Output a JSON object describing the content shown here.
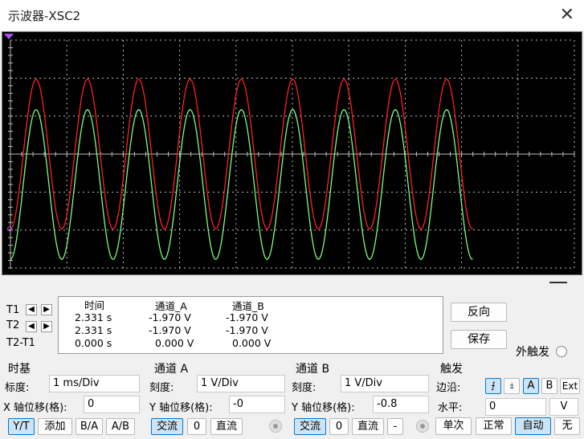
{
  "window": {
    "title": "示波器-XSC2",
    "close_glyph": "✕"
  },
  "screen": {
    "colors": {
      "background": "#000000",
      "grid": "#bdbdbd",
      "channel_a": "#ff2020",
      "channel_b": "#7dfc7d"
    }
  },
  "chart_data": {
    "type": "line",
    "x_unit": "div",
    "y_unit": "div",
    "xlim": [
      0,
      10
    ],
    "ylim": [
      -3,
      3
    ],
    "grid": true,
    "series": [
      {
        "name": "通道_A",
        "color": "#ff2020",
        "offset": 0,
        "amplitude": 1.97,
        "period_div": 0.91,
        "x_end": 8.2
      },
      {
        "name": "通道_B",
        "color": "#7dfc7d",
        "offset": -0.8,
        "amplitude": 1.97,
        "period_div": 0.91,
        "x_end": 8.2
      }
    ]
  },
  "readout": {
    "headers": [
      "时间",
      "通道_A",
      "通道_B"
    ],
    "rows": [
      {
        "label": "T1",
        "time": "2.331 s",
        "a": "-1.970 V",
        "b": "-1.970 V"
      },
      {
        "label": "T2",
        "time": "2.331 s",
        "a": "-1.970 V",
        "b": "-1.970 V"
      },
      {
        "label": "T2-T1",
        "time": "0.000 s",
        "a": "0.000 V",
        "b": "0.000 V"
      }
    ],
    "arrow_left": "◀",
    "arrow_right": "▶"
  },
  "buttons": {
    "reverse": "反向",
    "save": "保存",
    "ext_trigger": "外触发"
  },
  "timebase": {
    "title": "时基",
    "scale_label": "标度:",
    "scale_value": "1 ms/Div",
    "xpos_label": "X 轴位移(格):",
    "xpos_value": "0",
    "modes": [
      "Y/T",
      "添加",
      "B/A",
      "A/B"
    ]
  },
  "channel_a": {
    "title": "通道 A",
    "scale_label": "刻度:",
    "scale_value": "1  V/Div",
    "ypos_label": "Y 轴位移(格):",
    "ypos_value": "-0",
    "coupling": [
      "交流",
      "0",
      "直流"
    ]
  },
  "channel_b": {
    "title": "通道 B",
    "scale_label": "刻度:",
    "scale_value": "1  V/Div",
    "ypos_label": "Y 轴位移(格):",
    "ypos_value": "-0.8",
    "coupling": [
      "交流",
      "0",
      "直流",
      "-"
    ]
  },
  "trigger": {
    "title": "触发",
    "edge_label": "边沿:",
    "edge_rise": "⨍",
    "edge_fall": "⤈",
    "sources": [
      "A",
      "B",
      "Ext"
    ],
    "level_label": "水平:",
    "level_value": "0",
    "level_unit": "V",
    "modes": [
      "单次",
      "正常",
      "自动",
      "无"
    ]
  }
}
